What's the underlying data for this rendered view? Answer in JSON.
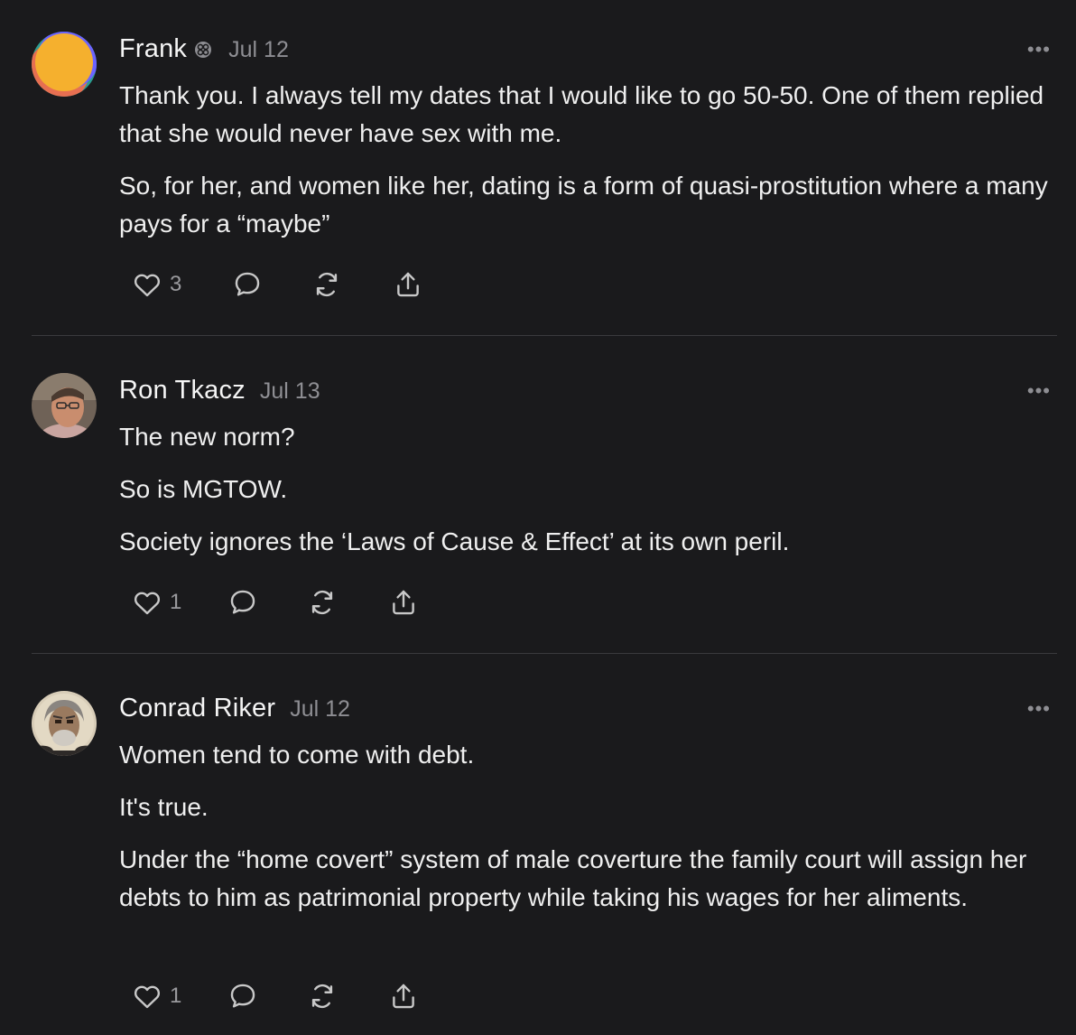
{
  "comments": [
    {
      "author": "Frank",
      "date": "Jul 12",
      "more": "•••",
      "paragraphs": [
        "Thank you. I always tell my dates that I would like to go 50-50. One of them replied that she would never have sex with me.",
        "So, for her, and women like her, dating is a form of quasi-prostitution where a many pays for a “maybe”"
      ],
      "like_count": "3",
      "avatar_colors": [
        "#f5a623",
        "#2a9d8f",
        "#e63946",
        "#6c63ff"
      ]
    },
    {
      "author": "Ron Tkacz",
      "date": "Jul 13",
      "more": "•••",
      "paragraphs": [
        "The new norm?",
        "So is MGTOW.",
        "Society ignores the ‘Laws of Cause & Effect’ at its own peril."
      ],
      "like_count": "1"
    },
    {
      "author": "Conrad Riker",
      "date": "Jul 12",
      "more": "•••",
      "paragraphs": [
        "Women tend to come with debt.",
        "It's true.",
        "Under the “home covert” system of male coverture the family court will assign her debts to him as patrimonial property while taking his wages for her aliments."
      ],
      "like_count": "1"
    }
  ],
  "icons": {
    "like": "heart-icon",
    "reply": "speech-bubble-icon",
    "restack": "restack-icon",
    "share": "share-icon",
    "badge": "subscriber-badge-icon"
  },
  "colors": {
    "background": "#1a1a1c",
    "text": "#efefef",
    "muted": "#8e8e93",
    "divider": "#3a3a3d"
  }
}
